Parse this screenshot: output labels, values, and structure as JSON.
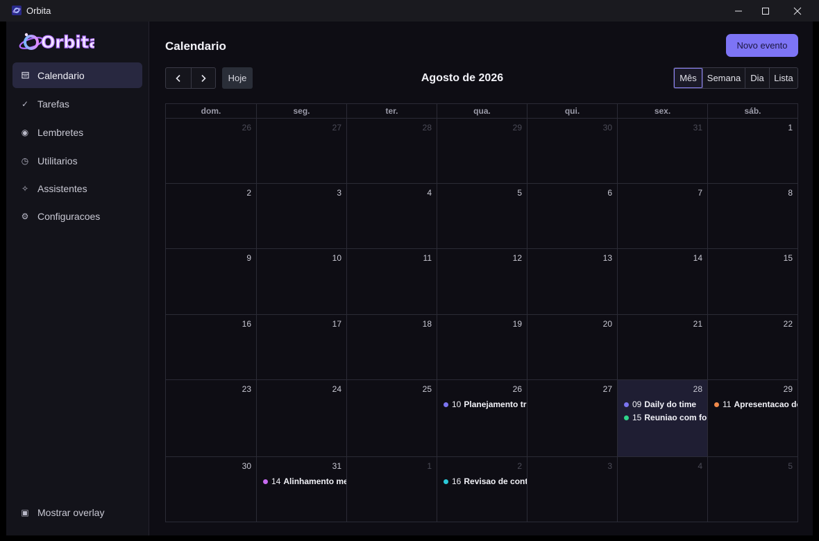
{
  "window": {
    "title": "Orbita",
    "controls": [
      "minimize",
      "maximize",
      "close"
    ]
  },
  "sidebar": {
    "logo_text": "Orbita",
    "items": [
      {
        "label": "Calendario",
        "icon": "calendar-icon",
        "active": true
      },
      {
        "label": "Tarefas",
        "icon": "check-icon"
      },
      {
        "label": "Lembretes",
        "icon": "bell-icon"
      },
      {
        "label": "Utilitarios",
        "icon": "clock-icon"
      },
      {
        "label": "Assistentes",
        "icon": "sparkle-icon"
      },
      {
        "label": "Configuracoes",
        "icon": "gear-icon"
      }
    ],
    "overlay_label": "Mostrar overlay"
  },
  "header": {
    "title": "Calendario",
    "new_event": "Novo evento",
    "today": "Hoje",
    "month": "Agosto de 2026",
    "views": [
      "Mês",
      "Semana",
      "Dia",
      "Lista"
    ],
    "active_view": "Mês"
  },
  "calendar": {
    "weekdays": [
      "dom.",
      "seg.",
      "ter.",
      "qua.",
      "qui.",
      "sex.",
      "sáb."
    ],
    "weeks": [
      [
        {
          "d": "26",
          "o": true
        },
        {
          "d": "27",
          "o": true
        },
        {
          "d": "28",
          "o": true
        },
        {
          "d": "29",
          "o": true
        },
        {
          "d": "30",
          "o": true
        },
        {
          "d": "31",
          "o": true
        },
        {
          "d": "1"
        }
      ],
      [
        {
          "d": "2"
        },
        {
          "d": "3"
        },
        {
          "d": "4"
        },
        {
          "d": "5"
        },
        {
          "d": "6"
        },
        {
          "d": "7"
        },
        {
          "d": "8"
        }
      ],
      [
        {
          "d": "9"
        },
        {
          "d": "10"
        },
        {
          "d": "11"
        },
        {
          "d": "12"
        },
        {
          "d": "13"
        },
        {
          "d": "14"
        },
        {
          "d": "15"
        }
      ],
      [
        {
          "d": "16"
        },
        {
          "d": "17"
        },
        {
          "d": "18"
        },
        {
          "d": "19"
        },
        {
          "d": "20"
        },
        {
          "d": "21"
        },
        {
          "d": "22"
        }
      ],
      [
        {
          "d": "23"
        },
        {
          "d": "24"
        },
        {
          "d": "25"
        },
        {
          "d": "26",
          "events": [
            {
              "time": "10",
              "title": "Planejamento trimestral",
              "color": "#7b74f0"
            }
          ]
        },
        {
          "d": "27"
        },
        {
          "d": "28",
          "today": true,
          "events": [
            {
              "time": "09",
              "title": "Daily do time",
              "color": "#7b74f0"
            },
            {
              "time": "15",
              "title": "Reuniao com fornecedor",
              "color": "#2fd48a"
            }
          ]
        },
        {
          "d": "29",
          "events": [
            {
              "time": "11",
              "title": "Apresentacao do projeto",
              "color": "#f0894a"
            }
          ]
        }
      ],
      [
        {
          "d": "30"
        },
        {
          "d": "31",
          "events": [
            {
              "time": "14",
              "title": "Alinhamento mensal",
              "color": "#c76af0"
            }
          ]
        },
        {
          "d": "1",
          "o": true
        },
        {
          "d": "2",
          "o": true,
          "events": [
            {
              "time": "16",
              "title": "Revisao de contratos",
              "color": "#2bc9d8"
            }
          ]
        },
        {
          "d": "3",
          "o": true
        },
        {
          "d": "4",
          "o": true
        },
        {
          "d": "5",
          "o": true
        }
      ]
    ]
  },
  "colors": {
    "accent": "#7d74f5",
    "today_bg": "#1f1e33",
    "sidebar_active": "#282840"
  }
}
